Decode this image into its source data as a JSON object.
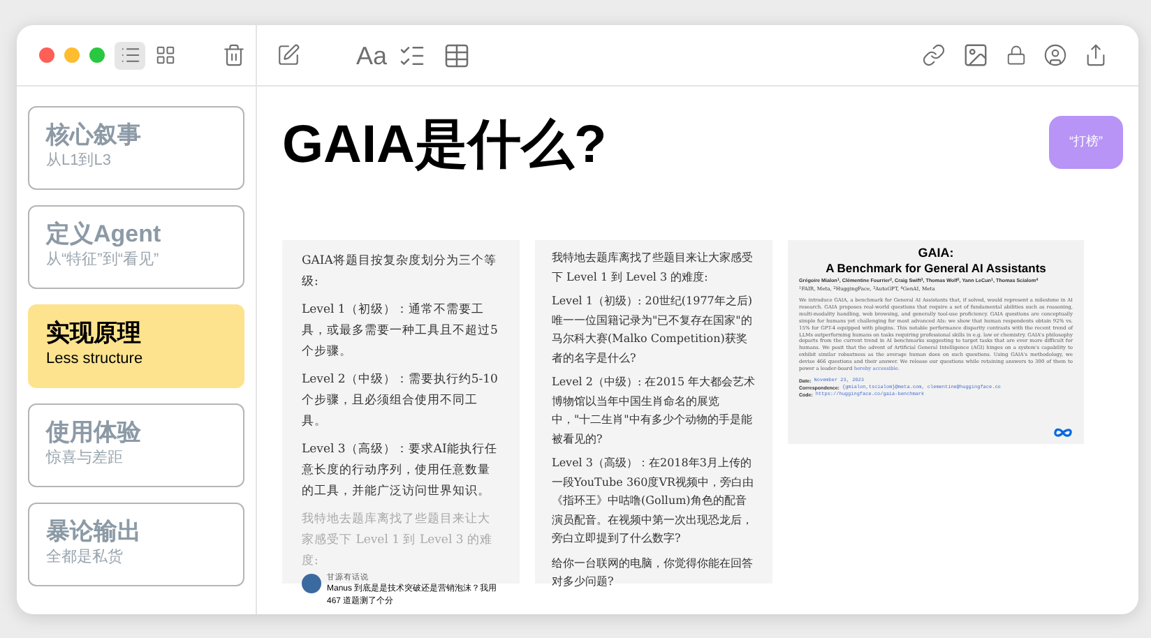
{
  "toolbar": {
    "views": [
      {
        "kind": "list",
        "selected": true
      },
      {
        "kind": "grid",
        "selected": false
      }
    ],
    "format_label": "Aa"
  },
  "sidebar": {
    "items": [
      {
        "title": "核心叙事",
        "subtitle": "从L1到L3",
        "selected": false
      },
      {
        "title": "定义Agent",
        "subtitle": "从“特征”到“看见”",
        "selected": false
      },
      {
        "title": "实现原理",
        "subtitle": "Less structure",
        "selected": true
      },
      {
        "title": "使用体验",
        "subtitle": "惊喜与差距",
        "selected": false
      },
      {
        "title": "暴论输出",
        "subtitle": "全都是私货",
        "selected": false
      }
    ]
  },
  "slide": {
    "title": "GAIA是什么?",
    "tag_button": "“打榜”",
    "card_1": {
      "paragraphs": [
        "GAIA将题目按复杂度划分为三个等级:",
        "Level 1（初级）：通常不需要工具，或最多需要一种工具且不超过5个步骤。",
        "Level 2（中级）：需要执行约5-10个步骤，且必须组合使用不同工具。",
        "Level 3（高级）：要求AI能执行任意长度的行动序列，使用任意数量的工具，并能广泛访问世界知识。"
      ],
      "faded": "我特地去题库离找了些题目来让大家感受下 Level 1 到 Level 3 的难度:",
      "author": "甘源有话说",
      "post_title": "Manus 到底是是技术突破还是营销泡沫？我用 467 道题测了个分"
    },
    "card_2": {
      "paragraphs": [
        "我特地去题库离找了些题目来让大家感受下 Level 1 到 Level 3 的难度:",
        "Level 1（初级）: 20世纪(1977年之后)唯一一位国籍记录为\"已不复存在国家\"的马尔科大赛(Malko Competition)获奖者的名字是什么?",
        "Level 2（中级）: 在2015 年大都会艺术博物馆以当年中国生肖命名的展览中，\"十二生肖\"中有多少个动物的手是能被看见的?",
        "Level 3（高级）：在2018年3月上传的一段YouTube 360度VR视频中，旁白由《指环王》中咕噜(Gollum)角色的配音演员配音。在视频中第一次出现恐龙后，旁白立即提到了什么数字?",
        "给你一台联网的电脑，你觉得你能在回答对多少问题?"
      ]
    },
    "card_3": {
      "title": "GAIA:",
      "subtitle": "A Benchmark for General AI Assistants",
      "authors": "Grégoire Mialon$^{1}$, Clémentine Fourrier$^{2}$, Craig Swift$^{3}$, Thomas Wolf$^{2}$, Yann LeCun$^{1}$, Thomas Scialom$^{4}$",
      "affiliations": "$^{1}$FAIR, Meta, $^{2}$HuggingFace, $^{3}$AutoGPT, $^{4}$GenAI, Meta",
      "abstract": "We introduce GAIA, a benchmark for General AI Assistants that, if solved, would represent a milestone in AI research. GAIA proposes real-world questions that require a set of fundamental abilities such as reasoning, multi-modality handling, web browsing, and generally tool-use proficiency. GAIA questions are conceptually simple for humans yet challenging for most advanced AIs: we show that human respondents obtain 92% vs. 15% for GPT-4 equipped with plugins. This notable performance disparity contrasts with the recent trend of LLMs outperforming humans on tasks requiring professional skills in e.g. law or chemistry. GAIA's philosophy departs from the current trend in AI benchmarks suggesting to target tasks that are ever more difficult for humans. We posit that the advent of Artificial General Intelligence (AGI) hinges on a system's capability to exhibit similar robustness as the average human does on such questions. Using GAIA's methodology, we devise 466 questions and their answer. We release our questions while retaining answers to 300 of them to power a leader-board",
      "abstract_link": "hereby accessible.",
      "meta": [
        {
          "label": "Date:",
          "value": "November 23, 2023"
        },
        {
          "label": "Correspondence:",
          "value": "{gmialon,tscialom}@meta.com, clementine@huggingface.co"
        },
        {
          "label": "Code:",
          "value": "https://huggingface.co/gaia-benchmark"
        }
      ]
    }
  }
}
